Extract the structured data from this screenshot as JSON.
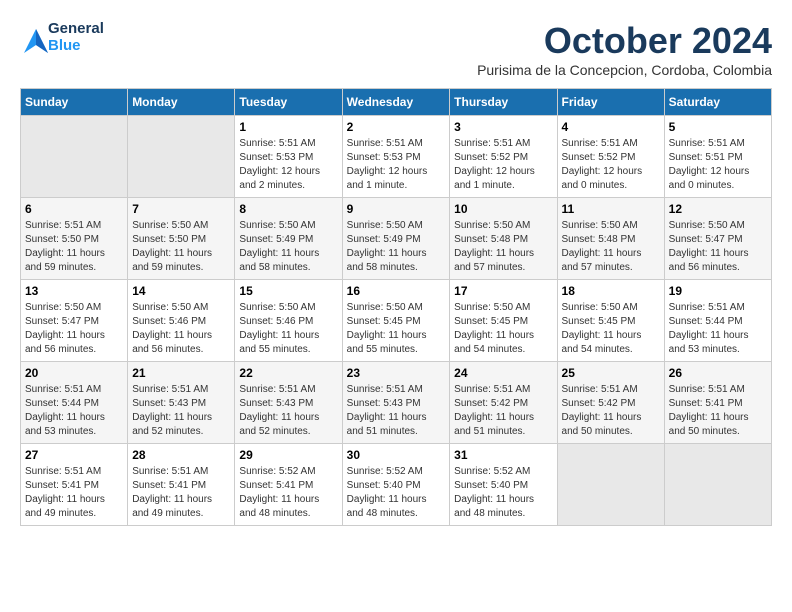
{
  "logo": {
    "line1": "General",
    "line2": "Blue"
  },
  "header": {
    "month": "October 2024",
    "location": "Purisima de la Concepcion, Cordoba, Colombia"
  },
  "weekdays": [
    "Sunday",
    "Monday",
    "Tuesday",
    "Wednesday",
    "Thursday",
    "Friday",
    "Saturday"
  ],
  "weeks": [
    [
      {
        "day": "",
        "sunrise": "",
        "sunset": "",
        "daylight": ""
      },
      {
        "day": "",
        "sunrise": "",
        "sunset": "",
        "daylight": ""
      },
      {
        "day": "1",
        "sunrise": "Sunrise: 5:51 AM",
        "sunset": "Sunset: 5:53 PM",
        "daylight": "Daylight: 12 hours and 2 minutes."
      },
      {
        "day": "2",
        "sunrise": "Sunrise: 5:51 AM",
        "sunset": "Sunset: 5:53 PM",
        "daylight": "Daylight: 12 hours and 1 minute."
      },
      {
        "day": "3",
        "sunrise": "Sunrise: 5:51 AM",
        "sunset": "Sunset: 5:52 PM",
        "daylight": "Daylight: 12 hours and 1 minute."
      },
      {
        "day": "4",
        "sunrise": "Sunrise: 5:51 AM",
        "sunset": "Sunset: 5:52 PM",
        "daylight": "Daylight: 12 hours and 0 minutes."
      },
      {
        "day": "5",
        "sunrise": "Sunrise: 5:51 AM",
        "sunset": "Sunset: 5:51 PM",
        "daylight": "Daylight: 12 hours and 0 minutes."
      }
    ],
    [
      {
        "day": "6",
        "sunrise": "Sunrise: 5:51 AM",
        "sunset": "Sunset: 5:50 PM",
        "daylight": "Daylight: 11 hours and 59 minutes."
      },
      {
        "day": "7",
        "sunrise": "Sunrise: 5:50 AM",
        "sunset": "Sunset: 5:50 PM",
        "daylight": "Daylight: 11 hours and 59 minutes."
      },
      {
        "day": "8",
        "sunrise": "Sunrise: 5:50 AM",
        "sunset": "Sunset: 5:49 PM",
        "daylight": "Daylight: 11 hours and 58 minutes."
      },
      {
        "day": "9",
        "sunrise": "Sunrise: 5:50 AM",
        "sunset": "Sunset: 5:49 PM",
        "daylight": "Daylight: 11 hours and 58 minutes."
      },
      {
        "day": "10",
        "sunrise": "Sunrise: 5:50 AM",
        "sunset": "Sunset: 5:48 PM",
        "daylight": "Daylight: 11 hours and 57 minutes."
      },
      {
        "day": "11",
        "sunrise": "Sunrise: 5:50 AM",
        "sunset": "Sunset: 5:48 PM",
        "daylight": "Daylight: 11 hours and 57 minutes."
      },
      {
        "day": "12",
        "sunrise": "Sunrise: 5:50 AM",
        "sunset": "Sunset: 5:47 PM",
        "daylight": "Daylight: 11 hours and 56 minutes."
      }
    ],
    [
      {
        "day": "13",
        "sunrise": "Sunrise: 5:50 AM",
        "sunset": "Sunset: 5:47 PM",
        "daylight": "Daylight: 11 hours and 56 minutes."
      },
      {
        "day": "14",
        "sunrise": "Sunrise: 5:50 AM",
        "sunset": "Sunset: 5:46 PM",
        "daylight": "Daylight: 11 hours and 56 minutes."
      },
      {
        "day": "15",
        "sunrise": "Sunrise: 5:50 AM",
        "sunset": "Sunset: 5:46 PM",
        "daylight": "Daylight: 11 hours and 55 minutes."
      },
      {
        "day": "16",
        "sunrise": "Sunrise: 5:50 AM",
        "sunset": "Sunset: 5:45 PM",
        "daylight": "Daylight: 11 hours and 55 minutes."
      },
      {
        "day": "17",
        "sunrise": "Sunrise: 5:50 AM",
        "sunset": "Sunset: 5:45 PM",
        "daylight": "Daylight: 11 hours and 54 minutes."
      },
      {
        "day": "18",
        "sunrise": "Sunrise: 5:50 AM",
        "sunset": "Sunset: 5:45 PM",
        "daylight": "Daylight: 11 hours and 54 minutes."
      },
      {
        "day": "19",
        "sunrise": "Sunrise: 5:51 AM",
        "sunset": "Sunset: 5:44 PM",
        "daylight": "Daylight: 11 hours and 53 minutes."
      }
    ],
    [
      {
        "day": "20",
        "sunrise": "Sunrise: 5:51 AM",
        "sunset": "Sunset: 5:44 PM",
        "daylight": "Daylight: 11 hours and 53 minutes."
      },
      {
        "day": "21",
        "sunrise": "Sunrise: 5:51 AM",
        "sunset": "Sunset: 5:43 PM",
        "daylight": "Daylight: 11 hours and 52 minutes."
      },
      {
        "day": "22",
        "sunrise": "Sunrise: 5:51 AM",
        "sunset": "Sunset: 5:43 PM",
        "daylight": "Daylight: 11 hours and 52 minutes."
      },
      {
        "day": "23",
        "sunrise": "Sunrise: 5:51 AM",
        "sunset": "Sunset: 5:43 PM",
        "daylight": "Daylight: 11 hours and 51 minutes."
      },
      {
        "day": "24",
        "sunrise": "Sunrise: 5:51 AM",
        "sunset": "Sunset: 5:42 PM",
        "daylight": "Daylight: 11 hours and 51 minutes."
      },
      {
        "day": "25",
        "sunrise": "Sunrise: 5:51 AM",
        "sunset": "Sunset: 5:42 PM",
        "daylight": "Daylight: 11 hours and 50 minutes."
      },
      {
        "day": "26",
        "sunrise": "Sunrise: 5:51 AM",
        "sunset": "Sunset: 5:41 PM",
        "daylight": "Daylight: 11 hours and 50 minutes."
      }
    ],
    [
      {
        "day": "27",
        "sunrise": "Sunrise: 5:51 AM",
        "sunset": "Sunset: 5:41 PM",
        "daylight": "Daylight: 11 hours and 49 minutes."
      },
      {
        "day": "28",
        "sunrise": "Sunrise: 5:51 AM",
        "sunset": "Sunset: 5:41 PM",
        "daylight": "Daylight: 11 hours and 49 minutes."
      },
      {
        "day": "29",
        "sunrise": "Sunrise: 5:52 AM",
        "sunset": "Sunset: 5:41 PM",
        "daylight": "Daylight: 11 hours and 48 minutes."
      },
      {
        "day": "30",
        "sunrise": "Sunrise: 5:52 AM",
        "sunset": "Sunset: 5:40 PM",
        "daylight": "Daylight: 11 hours and 48 minutes."
      },
      {
        "day": "31",
        "sunrise": "Sunrise: 5:52 AM",
        "sunset": "Sunset: 5:40 PM",
        "daylight": "Daylight: 11 hours and 48 minutes."
      },
      {
        "day": "",
        "sunrise": "",
        "sunset": "",
        "daylight": ""
      },
      {
        "day": "",
        "sunrise": "",
        "sunset": "",
        "daylight": ""
      }
    ]
  ]
}
